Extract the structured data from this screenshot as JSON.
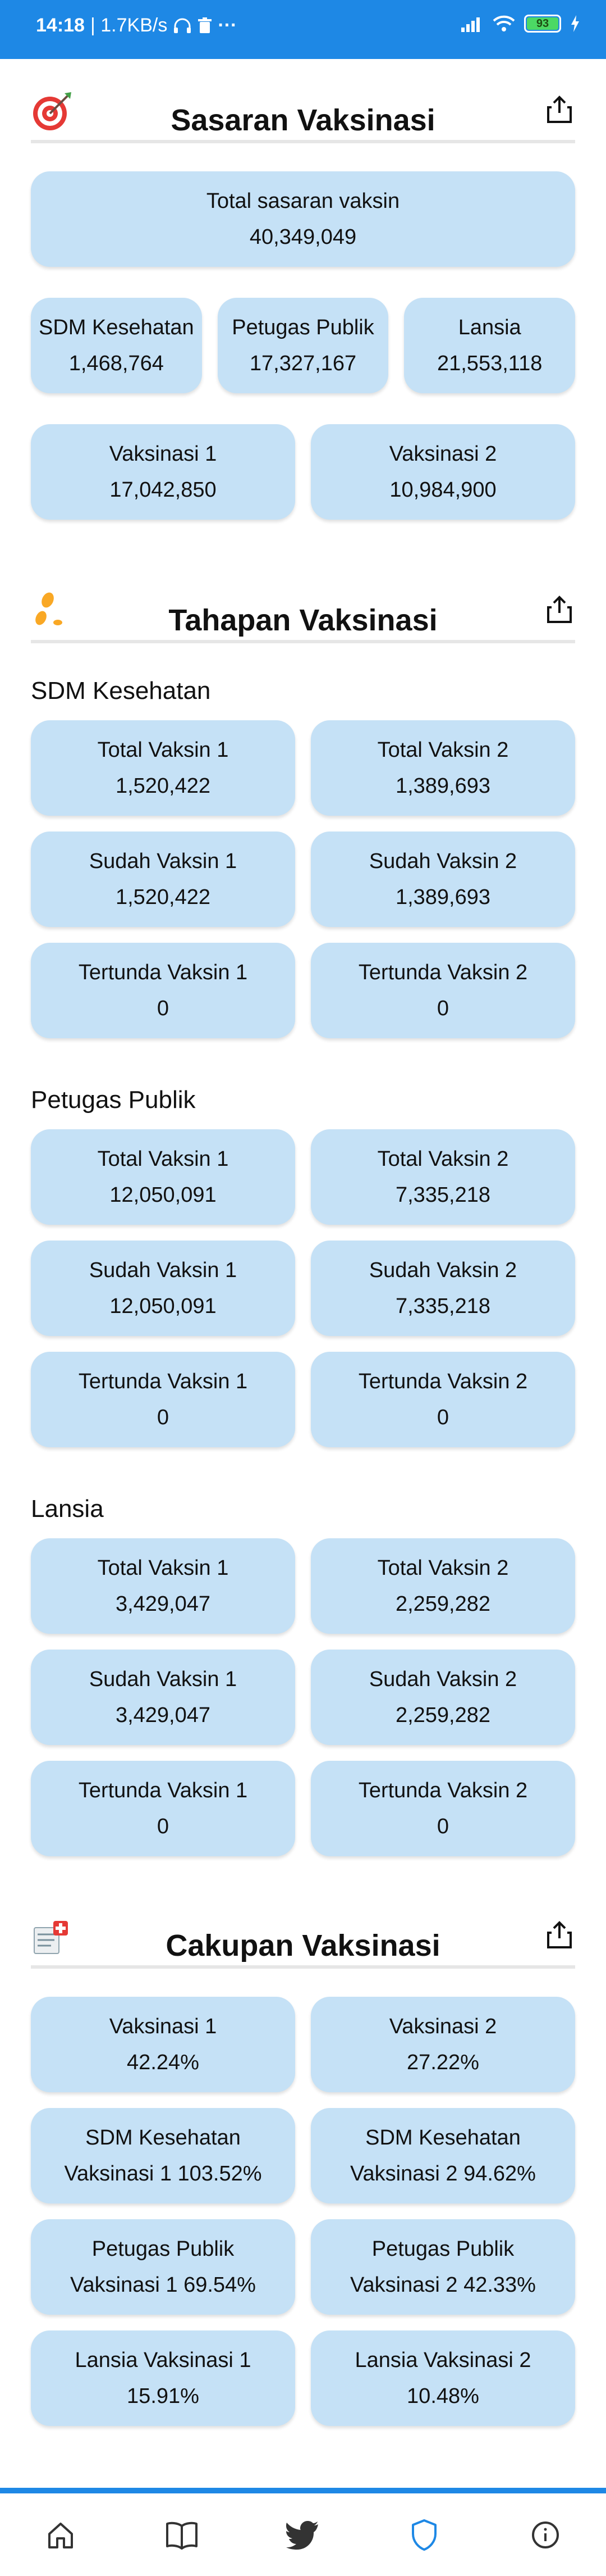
{
  "status_bar": {
    "time": "14:18",
    "speed": "| 1.7KB/s",
    "dots": "···",
    "battery": "93"
  },
  "sections": {
    "sasaran": {
      "title": "Sasaran Vaksinasi",
      "total": {
        "label": "Total sasaran vaksin",
        "value": "40,349,049"
      },
      "row1": [
        {
          "label": "SDM Kesehatan",
          "value": "1,468,764"
        },
        {
          "label": "Petugas Publik",
          "value": "17,327,167"
        },
        {
          "label": "Lansia",
          "value": "21,553,118"
        }
      ],
      "row2": [
        {
          "label": "Vaksinasi 1",
          "value": "17,042,850"
        },
        {
          "label": "Vaksinasi 2",
          "value": "10,984,900"
        }
      ]
    },
    "tahapan": {
      "title": "Tahapan Vaksinasi",
      "groups": [
        {
          "name": "SDM Kesehatan",
          "cards": [
            {
              "label": "Total Vaksin 1",
              "value": "1,520,422"
            },
            {
              "label": "Total Vaksin 2",
              "value": "1,389,693"
            },
            {
              "label": "Sudah Vaksin 1",
              "value": "1,520,422"
            },
            {
              "label": "Sudah Vaksin 2",
              "value": "1,389,693"
            },
            {
              "label": "Tertunda Vaksin 1",
              "value": "0"
            },
            {
              "label": "Tertunda Vaksin 2",
              "value": "0"
            }
          ]
        },
        {
          "name": "Petugas Publik",
          "cards": [
            {
              "label": "Total Vaksin 1",
              "value": "12,050,091"
            },
            {
              "label": "Total Vaksin 2",
              "value": "7,335,218"
            },
            {
              "label": "Sudah Vaksin 1",
              "value": "12,050,091"
            },
            {
              "label": "Sudah Vaksin 2",
              "value": "7,335,218"
            },
            {
              "label": "Tertunda Vaksin 1",
              "value": "0"
            },
            {
              "label": "Tertunda Vaksin 2",
              "value": "0"
            }
          ]
        },
        {
          "name": "Lansia",
          "cards": [
            {
              "label": "Total Vaksin 1",
              "value": "3,429,047"
            },
            {
              "label": "Total Vaksin 2",
              "value": "2,259,282"
            },
            {
              "label": "Sudah Vaksin 1",
              "value": "3,429,047"
            },
            {
              "label": "Sudah Vaksin 2",
              "value": "2,259,282"
            },
            {
              "label": "Tertunda Vaksin 1",
              "value": "0"
            },
            {
              "label": "Tertunda Vaksin 2",
              "value": "0"
            }
          ]
        }
      ]
    },
    "cakupan": {
      "title": "Cakupan Vaksinasi",
      "cards": [
        {
          "label": "Vaksinasi 1",
          "value": "42.24%"
        },
        {
          "label": "Vaksinasi 2",
          "value": "27.22%"
        },
        {
          "label": "SDM Kesehatan",
          "value": "Vaksinasi 1 103.52%"
        },
        {
          "label": "SDM Kesehatan",
          "value": "Vaksinasi 2 94.62%"
        },
        {
          "label": "Petugas Publik",
          "value": "Vaksinasi 1 69.54%"
        },
        {
          "label": "Petugas Publik",
          "value": "Vaksinasi 2 42.33%"
        },
        {
          "label": "Lansia Vaksinasi 1",
          "value": "15.91%"
        },
        {
          "label": "Lansia Vaksinasi 2",
          "value": "10.48%"
        }
      ]
    }
  },
  "bottom_nav": {
    "items": [
      "home-icon",
      "book-icon",
      "twitter-icon",
      "shield-icon",
      "info-icon"
    ],
    "active": "shield-icon",
    "active_color": "#1e88e5"
  },
  "colors": {
    "accent": "#1e88e5",
    "card": "#c5e1f6"
  }
}
